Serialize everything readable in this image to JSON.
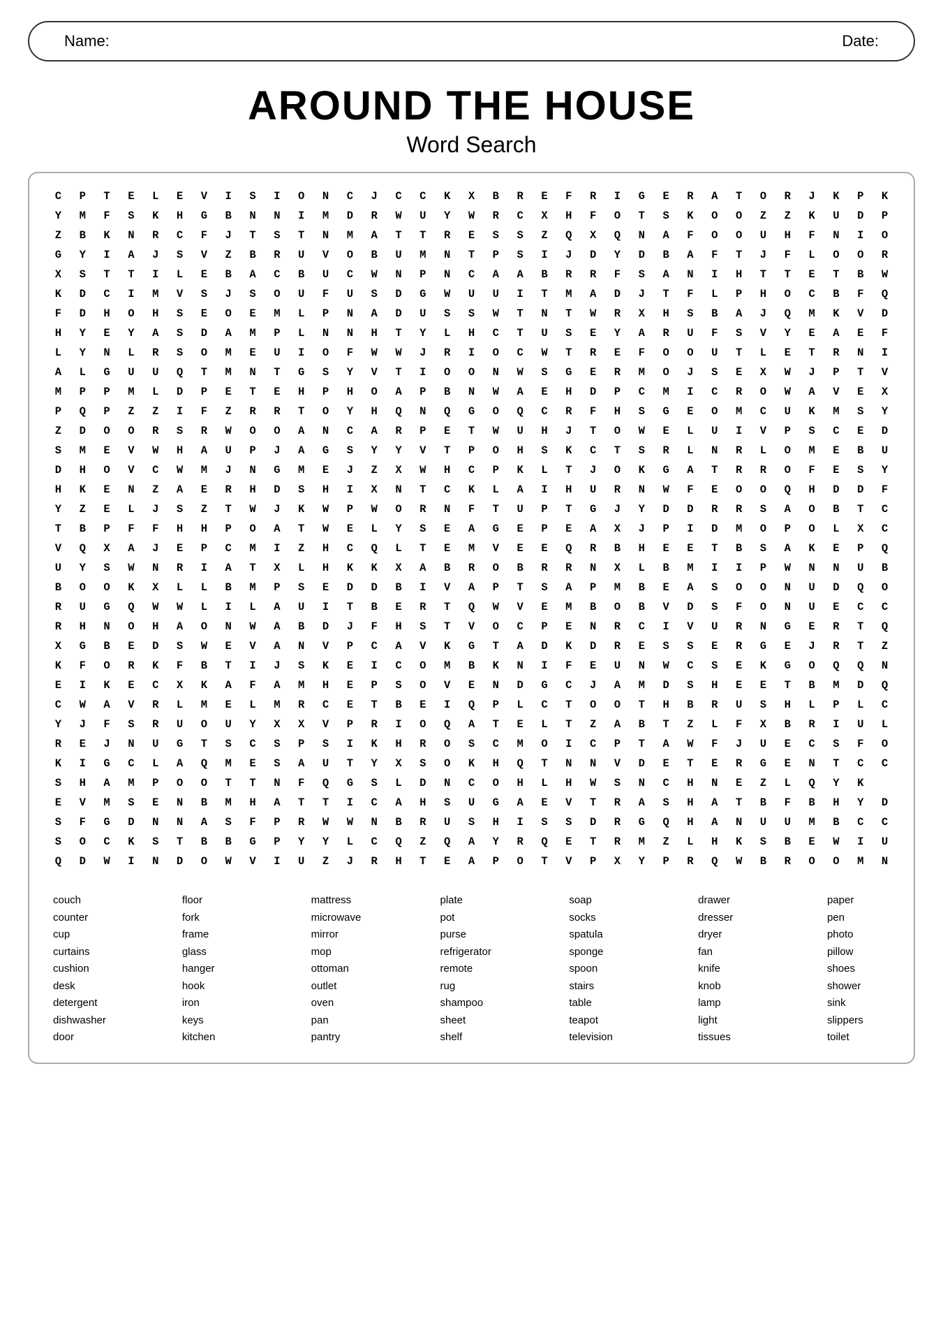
{
  "nameBar": {
    "nameLabel": "Name:",
    "dateLabel": "Date:"
  },
  "title": {
    "main": "Around The House",
    "subtitle": "Word Search"
  },
  "grid": [
    "C P T E L E V I S I O N C J C C K X B R E F R I G E R A T O R J K P K",
    "Y M F S K H G B N N I M D R W U Y W R C X H F O T S K O O Z Z K U D P",
    "Z B K N R C F J T S T N M A T T R E S S Z Q X Q N A F O O U H F N I O",
    "G Y I A J S V Z B R U V O B U M N T P S I J D Y D B A F T J F L O O R",
    "X S T T I L E B A C B U C W N P N C A A B R R F S A N I H T T E T B W",
    "K D C I M V S J S O U F U S D G W U U I T M A D J T F L P H O C B F Q",
    "F D H O H S E O E M L P N A D U S S W T N T W R X H S B A J Q M K V D",
    "H Y E Y A S D A M P L N N H T Y L H C T U S E Y A R U F S V Y E A E F",
    "L Y N L R S O M E U I O F W W J R I O C W T R E F O O U T L E T R N I",
    "A L G U U Q T M N T G S Y V T I O O N W S G E R M O J S E X W J P T V",
    "M P P M L D P E T E H P H O A P B N W A E H D P C M I C R O W A V E X",
    "P Q P Z Z I F Z R R T O Y H Q N Q G O Q C R F H S G E O M C U K M S Y",
    "Z D O O R S R W O O A N C A R P E T W U H J T O W E L U I V P S C E D",
    "S M E V W H A U P J A G S Y Y V T P O H S K C T S R L N R L O M E B U",
    "D H O V C W M J N G M E J Z X W H C P K L T J O K G A T R R O F E S Y",
    "H K E N Z A E R H D S H I X N T C K L A I H U R N W F E O O Q H D D F",
    "Y Z E L J S Z T W J K W P W O R N F T U P T G J Y D D R R S A O B T C",
    "T B P F F H H P O A T W E L Y S E A G E P E A X J P I D M O P O L X C",
    "V Q X A J E P C M I Z H C Q L T E M V E E Q R B H E E T B S A K E P Q",
    "U Y S W N R I A T X L H K K X A B R O B R R N X L B M I I P W N N U B",
    "B O O K X L L B M P S E D D B I V A P T S A P M B E A S O O N U D Q O",
    "R U G Q W W L I L A U I T B E R T Q W V E M B O B V D S F O N U E C C",
    "R H N O H A O N W A B D J F H S T V O C P E N R C I V U R N G E R T Q",
    "X G B E D S W E V A N V P C A V K G T A D K D R E S S E R G E J R T Z",
    "K F O R K F B T I J S K E I C O M B K N I F E U N W C S E K G O Q Q N",
    "E I K E C X K A F A M H E P S O V E N D G C J A M D S H E E T B M D Q",
    "C W A V R L M E L M R C E T B E I Q P L C T O O T H B R U S H L P L C",
    "Y J F S R U O U Y X X V P R I O Q A T E L T Z A B T Z L F X B R I U L",
    "R E J N U G T S C S P S I K H R O S C M O I C P T A W F J U E C S F O",
    "K I G C L A Q M E S A U T Y X S O K H Q T N N V D E T E R G E N T C C",
    "S H A M P O O T T N F Q G S L D N C O H L H W S N C H N E Z L Q Y K",
    "E V M S E N B M H A T T I C A H S U G A E V T R A S H A T B F B H Y D",
    "S F G D N N A S F P R W W N B R U S H I S S D R G Q H A N U U M B C C",
    "S O C K S T B B G P Y Y L C Q Z Q A Y R Q E T R M Z L H K S B E W I U",
    "Q D W I N D O W V I U Z J R H T E A P O T V P X Y P R Q W B R O O M N"
  ],
  "wordList": {
    "col1": [
      "couch",
      "counter",
      "cup",
      "curtains",
      "cushion",
      "desk",
      "detergent",
      "dishwasher",
      "door"
    ],
    "col2": [
      "floor",
      "fork",
      "frame",
      "glass",
      "hanger",
      "hook",
      "iron",
      "keys",
      "kitchen"
    ],
    "col3": [
      "mattress",
      "microwave",
      "mirror",
      "mop",
      "ottoman",
      "outlet",
      "oven",
      "pan",
      "pantry"
    ],
    "col4": [
      "plate",
      "pot",
      "purse",
      "refrigerator",
      "remote",
      "rug",
      "shampoo",
      "sheet",
      "shelf"
    ],
    "col5": [
      "soap",
      "socks",
      "spatula",
      "sponge",
      "spoon",
      "stairs",
      "table",
      "teapot",
      "television"
    ],
    "col6": [
      "drawer",
      "dresser",
      "dryer",
      "fan",
      "knife",
      "knob",
      "lamp",
      "light",
      "tissues"
    ],
    "col7": [
      "paper",
      "pen",
      "photo",
      "pillow",
      "shoes",
      "shower",
      "sink",
      "slippers",
      "toilet"
    ]
  }
}
